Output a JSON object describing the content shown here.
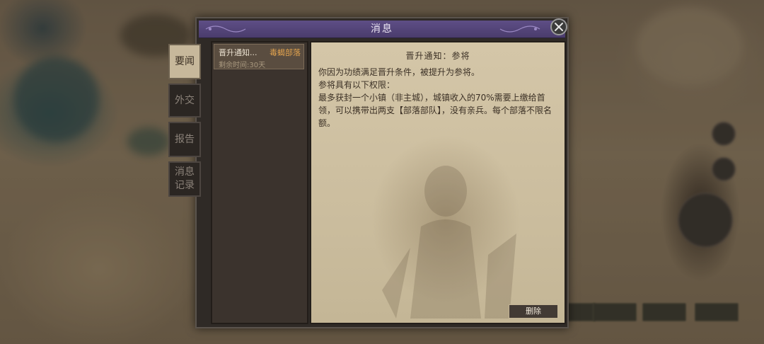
{
  "dialog": {
    "title": "消息",
    "close_icon": "close-icon"
  },
  "tabs": [
    {
      "label": "要闻",
      "active": true
    },
    {
      "label": "外交",
      "active": false
    },
    {
      "label": "报告",
      "active": false
    },
    {
      "label": "消息\n记录",
      "active": false
    }
  ],
  "messages": [
    {
      "title": "晋升通知...",
      "tag": "毒蝎部落",
      "remaining": "剩余时间:30天",
      "selected": true
    }
  ],
  "detail": {
    "heading": "晋升通知：参将",
    "body": "你因为功绩满足晋升条件，被提升为参将。\n参将具有以下权限：\n最多获封一个小镇（非主城），城镇收入的70%需要上缴给首领，可以携带出两支【部落部队】，没有亲兵。每个部落不限名额。",
    "delete_label": "删除"
  },
  "colors": {
    "title_bar": "#4a3c6c",
    "tag": "#e0a24e",
    "parchment": "#cbbd9e"
  }
}
